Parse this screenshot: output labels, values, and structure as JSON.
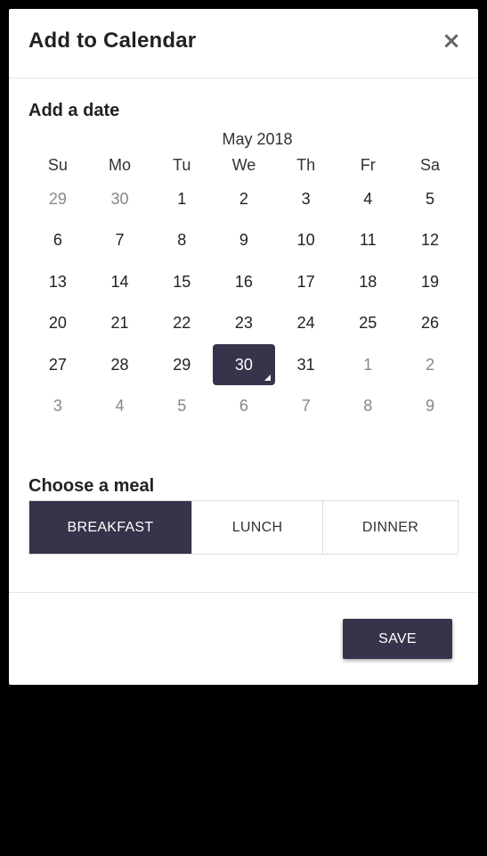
{
  "modal": {
    "title": "Add to Calendar",
    "close_icon": "close-icon",
    "close_glyph": "×"
  },
  "date_section": {
    "label": "Add a date"
  },
  "calendar": {
    "month_title": "May 2018",
    "weekdays": [
      "Su",
      "Mo",
      "Tu",
      "We",
      "Th",
      "Fr",
      "Sa"
    ],
    "weeks": [
      [
        {
          "d": "29",
          "muted": true
        },
        {
          "d": "30",
          "muted": true
        },
        {
          "d": "1"
        },
        {
          "d": "2"
        },
        {
          "d": "3"
        },
        {
          "d": "4"
        },
        {
          "d": "5"
        }
      ],
      [
        {
          "d": "6"
        },
        {
          "d": "7"
        },
        {
          "d": "8"
        },
        {
          "d": "9"
        },
        {
          "d": "10"
        },
        {
          "d": "11"
        },
        {
          "d": "12"
        }
      ],
      [
        {
          "d": "13"
        },
        {
          "d": "14"
        },
        {
          "d": "15"
        },
        {
          "d": "16"
        },
        {
          "d": "17"
        },
        {
          "d": "18"
        },
        {
          "d": "19"
        }
      ],
      [
        {
          "d": "20"
        },
        {
          "d": "21"
        },
        {
          "d": "22"
        },
        {
          "d": "23"
        },
        {
          "d": "24"
        },
        {
          "d": "25"
        },
        {
          "d": "26"
        }
      ],
      [
        {
          "d": "27"
        },
        {
          "d": "28"
        },
        {
          "d": "29"
        },
        {
          "d": "30",
          "selected": true
        },
        {
          "d": "31"
        },
        {
          "d": "1",
          "muted": true
        },
        {
          "d": "2",
          "muted": true
        }
      ],
      [
        {
          "d": "3",
          "muted": true
        },
        {
          "d": "4",
          "muted": true
        },
        {
          "d": "5",
          "muted": true
        },
        {
          "d": "6",
          "muted": true
        },
        {
          "d": "7",
          "muted": true
        },
        {
          "d": "8",
          "muted": true
        },
        {
          "d": "9",
          "muted": true
        }
      ]
    ],
    "selected_date": "30"
  },
  "meal_section": {
    "label": "Choose a meal",
    "options": [
      {
        "label": "BREAKFAST",
        "active": true
      },
      {
        "label": "LUNCH",
        "active": false
      },
      {
        "label": "DINNER",
        "active": false
      }
    ]
  },
  "footer": {
    "save_label": "SAVE"
  },
  "colors": {
    "accent": "#36334a",
    "backdrop": "#000000",
    "modal_bg": "#ffffff",
    "muted_text": "#888888"
  }
}
